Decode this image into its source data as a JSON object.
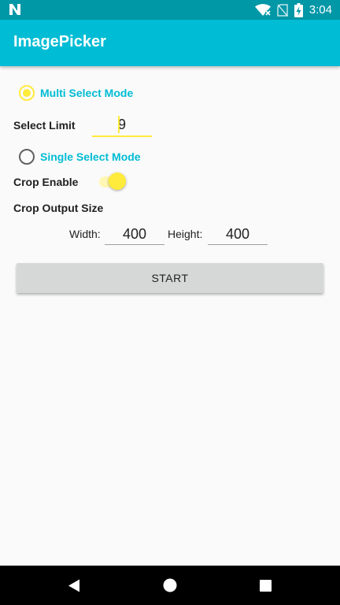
{
  "status_bar": {
    "time": "3:04",
    "icons": [
      "n-icon",
      "wifi-icon",
      "no-sim-icon",
      "battery-charging-icon"
    ]
  },
  "app_bar": {
    "title": "ImagePicker"
  },
  "multi_select": {
    "label": "Multi Select Mode",
    "checked": true
  },
  "select_limit": {
    "label": "Select Limit",
    "value": "9"
  },
  "single_select": {
    "label": "Single Select Mode",
    "checked": false
  },
  "crop_enable": {
    "label": "Crop Enable",
    "enabled": true
  },
  "crop_output": {
    "label": "Crop Output Size",
    "width_label": "Width:",
    "width_value": "400",
    "height_label": "Height:",
    "height_value": "400"
  },
  "start_button": {
    "label": "START"
  },
  "nav_bar": {
    "icons": [
      "back-icon",
      "home-icon",
      "recents-icon"
    ]
  },
  "colors": {
    "primary": "#00bcd4",
    "primary_dark": "#0097a7",
    "accent": "#ffeb3b",
    "button": "#d6d7d7"
  }
}
